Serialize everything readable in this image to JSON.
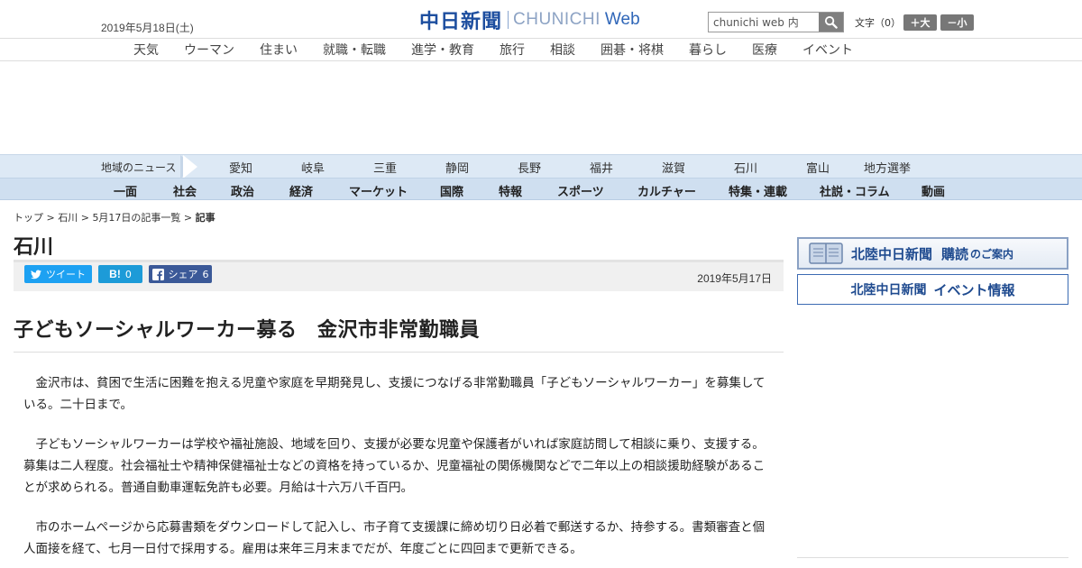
{
  "header": {
    "date": "2019年5月18日(土)",
    "logo_jp": "中日新聞",
    "logo_en": "CHUNICHI",
    "logo_web": "Web",
    "search_placeholder": "chunichi web 内",
    "text_size_label": "文字（0）",
    "size_up_label": "＋大",
    "size_down_label": "－小"
  },
  "life_nav": [
    "天気",
    "ウーマン",
    "住まい",
    "就職・転職",
    "進学・教育",
    "旅行",
    "相談",
    "囲碁・将棋",
    "暮らし",
    "医療",
    "イベント"
  ],
  "region_nav": {
    "label": "地域のニュース",
    "items": [
      "愛知",
      "岐阜",
      "三重",
      "静岡",
      "長野",
      "福井",
      "滋賀",
      "石川",
      "富山",
      "地方選挙"
    ]
  },
  "category_nav": [
    "一面",
    "社会",
    "政治",
    "経済",
    "マーケット",
    "国際",
    "特報",
    "スポーツ",
    "カルチャー",
    "特集・連載",
    "社説・コラム",
    "動画"
  ],
  "breadcrumb": {
    "top": "トップ",
    "region": "石川",
    "list": "5月17日の記事一覧",
    "current": "記事",
    "sep": " > "
  },
  "section_title": "石川",
  "share": {
    "tweet": "ツイート",
    "hatena_count": "0",
    "share_label": "シェア",
    "share_count": "6"
  },
  "article": {
    "date": "2019年5月17日",
    "headline": "子どもソーシャルワーカー募る　金沢市非常勤職員",
    "paragraphs": [
      "金沢市は、貧困で生活に困難を抱える児童や家庭を早期発見し、支援につなげる非常勤職員「子どもソーシャルワーカー」を募集している。二十日まで。",
      "子どもソーシャルワーカーは学校や福祉施設、地域を回り、支援が必要な児童や保護者がいれば家庭訪問して相談に乗り、支援する。募集は二人程度。社会福祉士や精神保健福祉士などの資格を持っているか、児童福祉の関係機関などで二年以上の相談援助経験があることが求められる。普通自動車運転免許も必要。月給は十六万八千百円。",
      "市のホームページから応募書類をダウンロードして記入し、市子育て支援課に締め切り日必着で郵送するか、持参する。書類審査と個人面接を経て、七月一日付で採用する。雇用は来年三月末までだが、年度ごとに四回まで更新できる。"
    ]
  },
  "sidebar": {
    "subscribe_banner": {
      "name": "北陸中日新聞",
      "action": "購読",
      "suffix": "のご案内"
    },
    "event_banner": {
      "name": "北陸中日新聞",
      "label": "イベント情報"
    }
  },
  "colors": {
    "brand": "#1d4e9f",
    "region_bar": "#dde9f5",
    "category_bar": "#cfdff0",
    "twitter": "#1da1f2",
    "hatena": "#1d9bd8",
    "facebook": "#3b5998"
  },
  "icons": [
    "search-icon",
    "twitter-icon",
    "hatena-icon",
    "facebook-icon",
    "book-icon"
  ]
}
